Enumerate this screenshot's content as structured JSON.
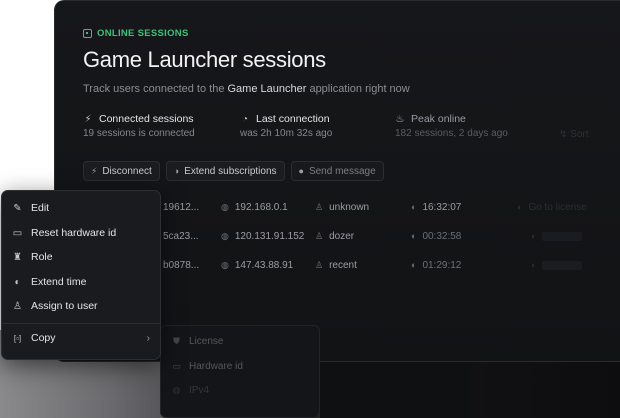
{
  "header": {
    "eyebrow": "ONLINE SESSIONS",
    "title": "Game Launcher sessions",
    "subtitle_prefix": "Track users connected to the ",
    "subtitle_app": "Game Launcher",
    "subtitle_suffix": " application right now"
  },
  "stats": [
    {
      "icon": "lightning-icon",
      "label": "Connected sessions",
      "value": "19 sessions is connected"
    },
    {
      "icon": "clock-icon",
      "label": "Last connection",
      "value": "was 2h 10m 32s ago"
    },
    {
      "icon": "flame-icon",
      "label": "Peak online",
      "value": "182 sessions, 2 days ago"
    }
  ],
  "stat4_fragment": "Sort",
  "actions": [
    {
      "icon": "disconnect-icon",
      "label": "Disconnect"
    },
    {
      "icon": "refresh-icon",
      "label": "Extend subscriptions"
    },
    {
      "icon": "chat-icon",
      "label": "Send message"
    }
  ],
  "rows": [
    {
      "id_fragment": "19612...",
      "ip": "192.168.0.1",
      "user": "unknown",
      "time": "16:32:07",
      "action": "Go to license"
    },
    {
      "id_fragment": "5ca23...",
      "ip": "120.131.91.152",
      "user": "dozer",
      "time": "00:32:58",
      "action": ""
    },
    {
      "id_fragment": "b0878...",
      "ip": "147.43.88.91",
      "user": "recent",
      "time": "01:29:12",
      "action": ""
    }
  ],
  "context_menu": {
    "items": [
      {
        "icon": "pencil-icon",
        "label": "Edit"
      },
      {
        "icon": "monitor-icon",
        "label": "Reset hardware id"
      },
      {
        "icon": "role-icon",
        "label": "Role"
      },
      {
        "icon": "half-circle-icon",
        "label": "Extend time"
      },
      {
        "icon": "user-icon",
        "label": "Assign to user"
      }
    ],
    "copy": {
      "icon": "brackets-icon",
      "label": "Copy",
      "chevron": "›"
    }
  },
  "submenu": {
    "items": [
      {
        "icon": "shield-icon",
        "label": "License"
      },
      {
        "icon": "monitor-icon",
        "label": "Hardware id"
      },
      {
        "icon": "globe-icon",
        "label": "IPv4"
      }
    ]
  },
  "colors": {
    "accent_green": "#3fbf7a",
    "panel_bg": "#16171a",
    "menu_bg": "#1a1b1e"
  }
}
